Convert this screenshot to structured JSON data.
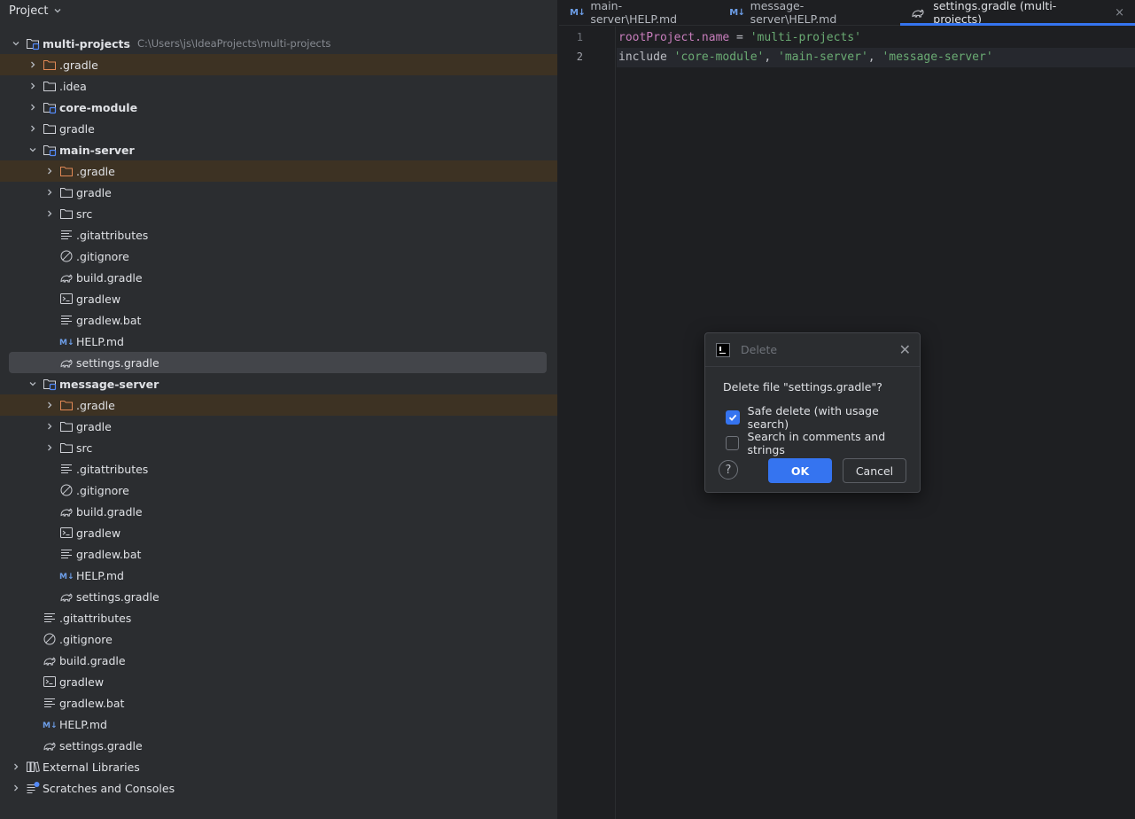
{
  "project_panel": {
    "title": "Project",
    "tree": [
      {
        "label": "multi-projects",
        "hint": "C:\\Users\\js\\IdeaProjects\\multi-projects",
        "icon": "module-folder-icon",
        "indent": 0,
        "expand": "open",
        "bold": true,
        "state": ""
      },
      {
        "label": ".gradle",
        "icon": "excluded-folder-icon",
        "indent": 1,
        "expand": "closed",
        "bold": false,
        "state": "excluded"
      },
      {
        "label": ".idea",
        "icon": "folder-icon",
        "indent": 1,
        "expand": "closed",
        "bold": false,
        "state": ""
      },
      {
        "label": "core-module",
        "icon": "module-folder-icon",
        "indent": 1,
        "expand": "closed",
        "bold": true,
        "state": ""
      },
      {
        "label": "gradle",
        "icon": "folder-icon",
        "indent": 1,
        "expand": "closed",
        "bold": false,
        "state": ""
      },
      {
        "label": "main-server",
        "icon": "module-folder-icon",
        "indent": 1,
        "expand": "open",
        "bold": true,
        "state": ""
      },
      {
        "label": ".gradle",
        "icon": "excluded-folder-icon",
        "indent": 2,
        "expand": "closed",
        "bold": false,
        "state": "excluded"
      },
      {
        "label": "gradle",
        "icon": "folder-icon",
        "indent": 2,
        "expand": "closed",
        "bold": false,
        "state": ""
      },
      {
        "label": "src",
        "icon": "folder-icon",
        "indent": 2,
        "expand": "closed",
        "bold": false,
        "state": ""
      },
      {
        "label": ".gitattributes",
        "icon": "text-file-icon",
        "indent": 2,
        "expand": "none",
        "bold": false,
        "state": ""
      },
      {
        "label": ".gitignore",
        "icon": "ignore-file-icon",
        "indent": 2,
        "expand": "none",
        "bold": false,
        "state": ""
      },
      {
        "label": "build.gradle",
        "icon": "gradle-elephant-icon",
        "indent": 2,
        "expand": "none",
        "bold": false,
        "state": ""
      },
      {
        "label": "gradlew",
        "icon": "terminal-file-icon",
        "indent": 2,
        "expand": "none",
        "bold": false,
        "state": ""
      },
      {
        "label": "gradlew.bat",
        "icon": "text-file-icon",
        "indent": 2,
        "expand": "none",
        "bold": false,
        "state": ""
      },
      {
        "label": "HELP.md",
        "icon": "markdown-icon",
        "indent": 2,
        "expand": "none",
        "bold": false,
        "state": ""
      },
      {
        "label": "settings.gradle",
        "icon": "gradle-elephant-icon",
        "indent": 2,
        "expand": "none",
        "bold": false,
        "state": "selected"
      },
      {
        "label": "message-server",
        "icon": "module-folder-icon",
        "indent": 1,
        "expand": "open",
        "bold": true,
        "state": ""
      },
      {
        "label": ".gradle",
        "icon": "excluded-folder-icon",
        "indent": 2,
        "expand": "closed",
        "bold": false,
        "state": "excluded"
      },
      {
        "label": "gradle",
        "icon": "folder-icon",
        "indent": 2,
        "expand": "closed",
        "bold": false,
        "state": ""
      },
      {
        "label": "src",
        "icon": "folder-icon",
        "indent": 2,
        "expand": "closed",
        "bold": false,
        "state": ""
      },
      {
        "label": ".gitattributes",
        "icon": "text-file-icon",
        "indent": 2,
        "expand": "none",
        "bold": false,
        "state": ""
      },
      {
        "label": ".gitignore",
        "icon": "ignore-file-icon",
        "indent": 2,
        "expand": "none",
        "bold": false,
        "state": ""
      },
      {
        "label": "build.gradle",
        "icon": "gradle-elephant-icon",
        "indent": 2,
        "expand": "none",
        "bold": false,
        "state": ""
      },
      {
        "label": "gradlew",
        "icon": "terminal-file-icon",
        "indent": 2,
        "expand": "none",
        "bold": false,
        "state": ""
      },
      {
        "label": "gradlew.bat",
        "icon": "text-file-icon",
        "indent": 2,
        "expand": "none",
        "bold": false,
        "state": ""
      },
      {
        "label": "HELP.md",
        "icon": "markdown-icon",
        "indent": 2,
        "expand": "none",
        "bold": false,
        "state": ""
      },
      {
        "label": "settings.gradle",
        "icon": "gradle-elephant-icon",
        "indent": 2,
        "expand": "none",
        "bold": false,
        "state": ""
      },
      {
        "label": ".gitattributes",
        "icon": "text-file-icon",
        "indent": 1,
        "expand": "none",
        "bold": false,
        "state": ""
      },
      {
        "label": ".gitignore",
        "icon": "ignore-file-icon",
        "indent": 1,
        "expand": "none",
        "bold": false,
        "state": ""
      },
      {
        "label": "build.gradle",
        "icon": "gradle-elephant-icon",
        "indent": 1,
        "expand": "none",
        "bold": false,
        "state": ""
      },
      {
        "label": "gradlew",
        "icon": "terminal-file-icon",
        "indent": 1,
        "expand": "none",
        "bold": false,
        "state": ""
      },
      {
        "label": "gradlew.bat",
        "icon": "text-file-icon",
        "indent": 1,
        "expand": "none",
        "bold": false,
        "state": ""
      },
      {
        "label": "HELP.md",
        "icon": "markdown-icon",
        "indent": 1,
        "expand": "none",
        "bold": false,
        "state": ""
      },
      {
        "label": "settings.gradle",
        "icon": "gradle-elephant-icon",
        "indent": 1,
        "expand": "none",
        "bold": false,
        "state": ""
      },
      {
        "label": "External Libraries",
        "icon": "library-icon",
        "indent": 0,
        "expand": "closed",
        "bold": false,
        "state": ""
      },
      {
        "label": "Scratches and Consoles",
        "icon": "scratches-icon",
        "indent": 0,
        "expand": "closed",
        "bold": false,
        "state": ""
      }
    ]
  },
  "editor": {
    "tabs": [
      {
        "badge": "M↓",
        "icon": "markdown-icon",
        "label": "main-server\\HELP.md",
        "active": false
      },
      {
        "badge": "M↓",
        "icon": "markdown-icon",
        "label": "message-server\\HELP.md",
        "active": false
      },
      {
        "badge": "",
        "icon": "gradle-elephant-icon",
        "label": "settings.gradle (multi-projects)",
        "active": true
      }
    ],
    "close_glyph": "×",
    "lines": [
      {
        "number": "1",
        "current": false,
        "tokens": [
          {
            "t": "rootProject.name",
            "c": "prop"
          },
          {
            "t": " = ",
            "c": "plain"
          },
          {
            "t": "'multi-projects'",
            "c": "str"
          }
        ]
      },
      {
        "number": "2",
        "current": true,
        "tokens": [
          {
            "t": "include ",
            "c": "plain"
          },
          {
            "t": "'core-module'",
            "c": "str"
          },
          {
            "t": ", ",
            "c": "plain"
          },
          {
            "t": "'main-server'",
            "c": "str"
          },
          {
            "t": ", ",
            "c": "plain"
          },
          {
            "t": "'message-server'",
            "c": "str"
          }
        ]
      }
    ]
  },
  "dialog": {
    "title": "Delete",
    "message": "Delete file \"settings.gradle\"?",
    "safe_delete_label": "Safe delete (with usage search)",
    "safe_delete_checked": true,
    "search_comments_label": "Search in comments and strings",
    "search_comments_checked": false,
    "help_label": "?",
    "ok_label": "OK",
    "cancel_label": "Cancel",
    "close_glyph": "✕"
  },
  "colors": {
    "accent": "#3574f0",
    "excluded_row": "#3d3223",
    "selected_row": "#43454a",
    "string": "#6aab73",
    "property": "#c77dbb"
  }
}
